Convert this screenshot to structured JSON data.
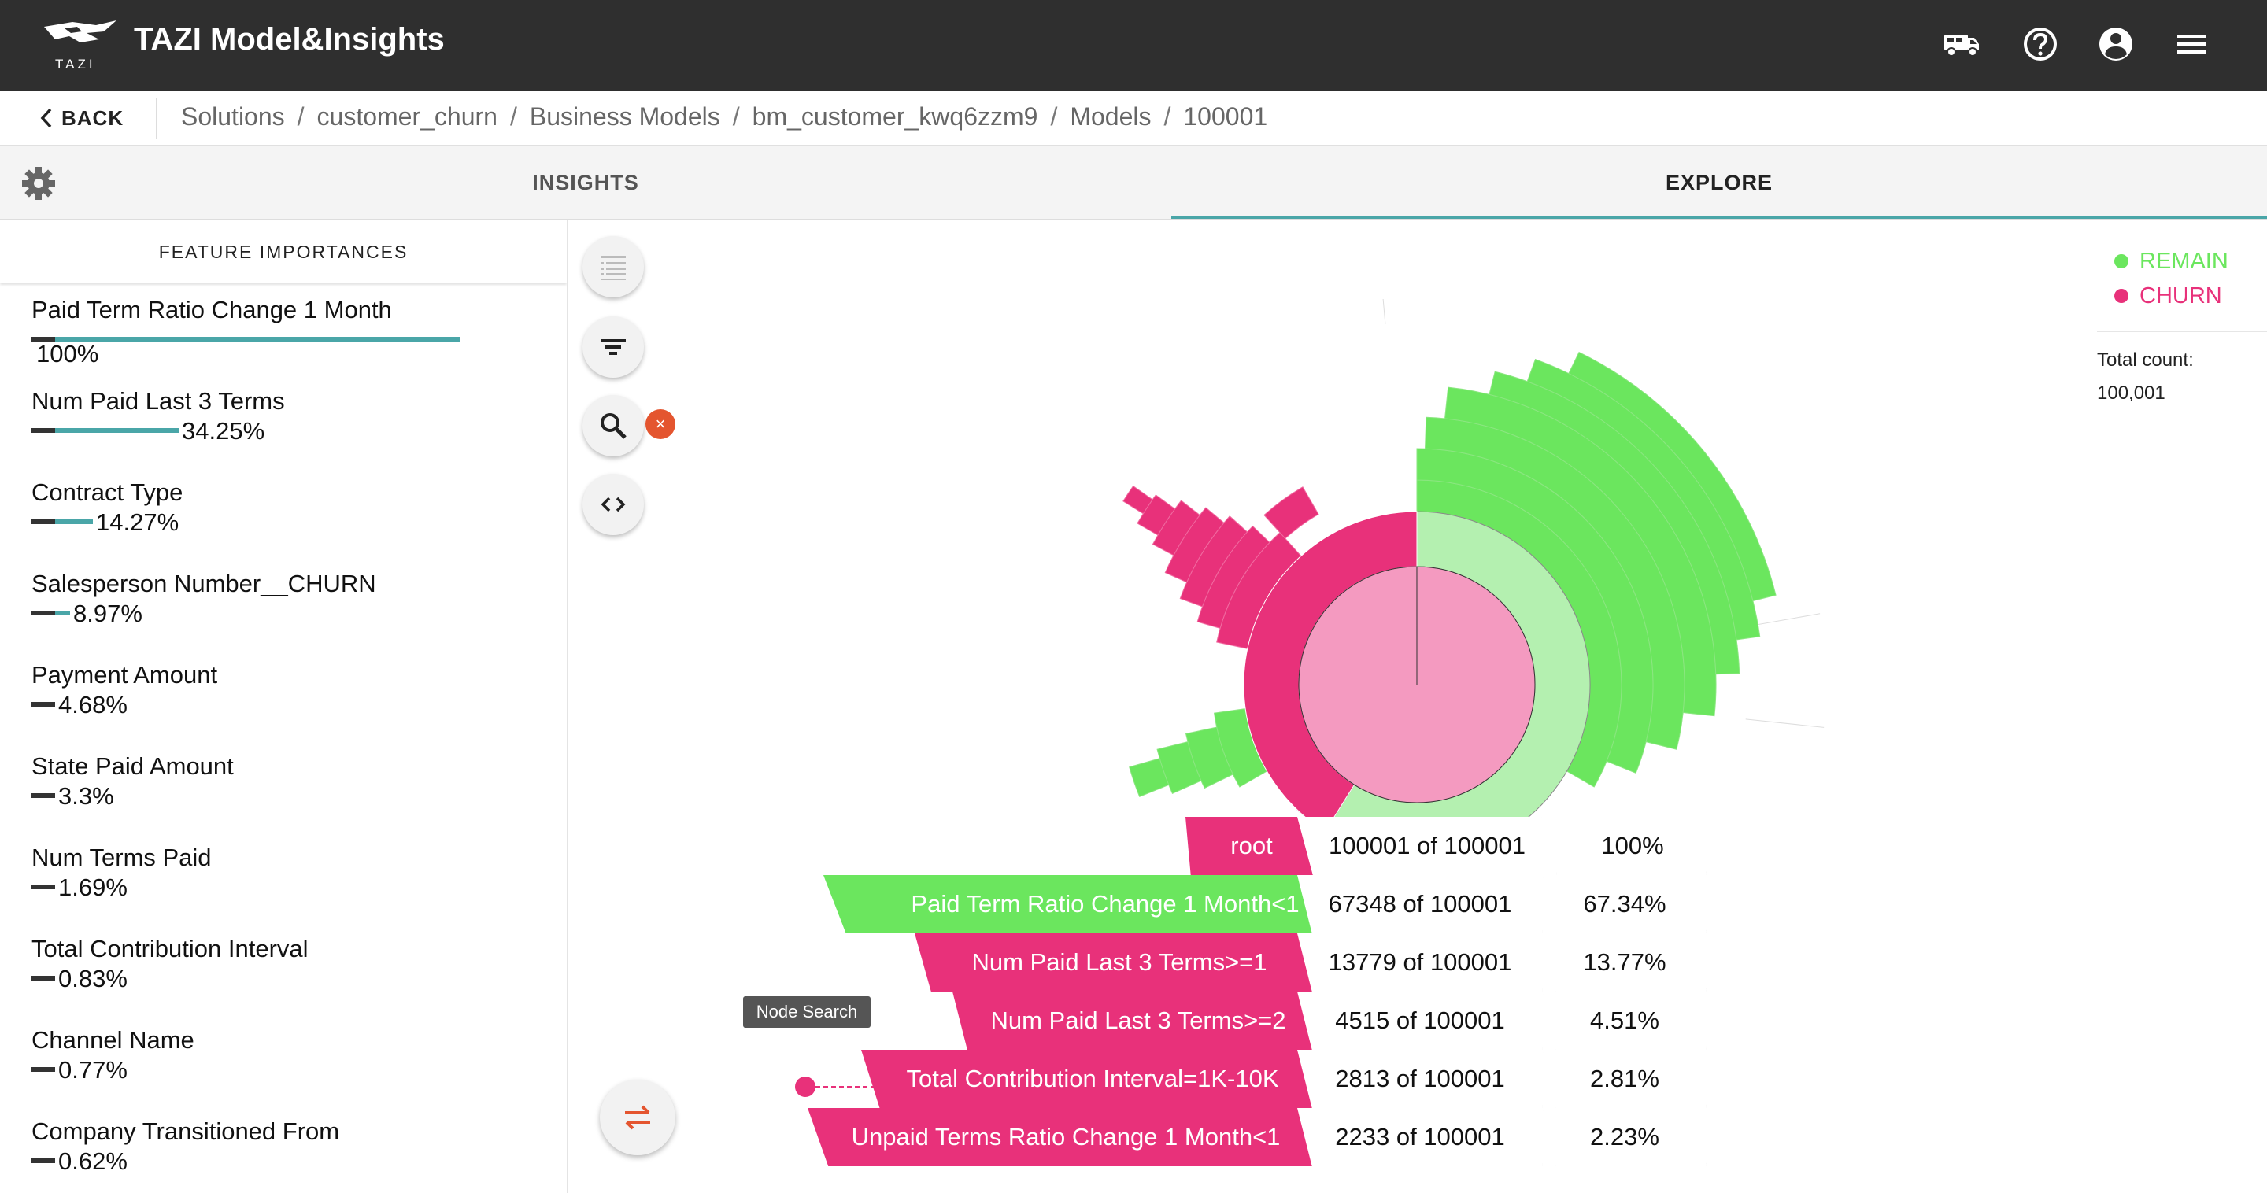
{
  "app": {
    "title": "TAZI Model&Insights",
    "logo_text": "TAZI"
  },
  "colors": {
    "remain": "#6be65e",
    "churn": "#e8317a",
    "remain_light": "#b4f0b0",
    "churn_light": "#f49ac0",
    "accent": "#4aa6a8",
    "topbar": "#2f2f2f"
  },
  "header_icons": [
    "truck-icon",
    "help-icon",
    "account-icon",
    "menu-icon"
  ],
  "breadcrumb": {
    "back_label": "BACK",
    "items": [
      "Solutions",
      "customer_churn",
      "Business Models",
      "bm_customer_kwq6zzm9",
      "Models",
      "100001"
    ],
    "separator": "/"
  },
  "tabs": [
    {
      "label": "INSIGHTS",
      "active": false
    },
    {
      "label": "EXPLORE",
      "active": true
    }
  ],
  "feature_importances": {
    "header": "FEATURE IMPORTANCES",
    "items": [
      {
        "name": "Paid Term Ratio Change 1 Month",
        "value": "100%",
        "fraction": 1.0
      },
      {
        "name": "Num Paid Last 3 Terms",
        "value": "34.25%",
        "fraction": 0.3425
      },
      {
        "name": "Contract Type",
        "value": "14.27%",
        "fraction": 0.1427
      },
      {
        "name": "Salesperson Number__CHURN",
        "value": "8.97%",
        "fraction": 0.0897
      },
      {
        "name": "Payment Amount",
        "value": "4.68%",
        "fraction": 0.0468
      },
      {
        "name": "State Paid Amount",
        "value": "3.3%",
        "fraction": 0.033
      },
      {
        "name": "Num Terms Paid",
        "value": "1.69%",
        "fraction": 0.0169
      },
      {
        "name": "Total Contribution Interval",
        "value": "0.83%",
        "fraction": 0.0083
      },
      {
        "name": "Channel Name",
        "value": "0.77%",
        "fraction": 0.0077
      },
      {
        "name": "Company Transitioned From",
        "value": "0.62%",
        "fraction": 0.0062
      }
    ]
  },
  "toolbar": {
    "buttons": [
      "table-view-icon",
      "filter-icon",
      "search-icon",
      "code-icon"
    ],
    "clear_label": "×",
    "tooltip": "Node Search"
  },
  "legend": {
    "items": [
      {
        "label": "REMAIN"
      },
      {
        "label": "CHURN"
      }
    ],
    "total_label": "Total count:",
    "total_value": "100,001"
  },
  "path": [
    {
      "label": "root",
      "count": "100001 of 100001",
      "pct": "100%",
      "class": "churn"
    },
    {
      "label": "Paid Term Ratio Change 1 Month<1",
      "count": "67348 of 100001",
      "pct": "67.34%",
      "class": "remain"
    },
    {
      "label": "Num Paid Last 3 Terms>=1",
      "count": "13779 of 100001",
      "pct": "13.77%",
      "class": "churn"
    },
    {
      "label": "Num Paid Last 3 Terms>=2",
      "count": "4515 of 100001",
      "pct": "4.51%",
      "class": "churn"
    },
    {
      "label": "Total Contribution Interval=1K-10K",
      "count": "2813 of 100001",
      "pct": "2.81%",
      "class": "churn"
    },
    {
      "label": "Unpaid Terms Ratio Change 1 Month<1",
      "count": "2233 of 100001",
      "pct": "2.23%",
      "class": "churn"
    }
  ]
}
